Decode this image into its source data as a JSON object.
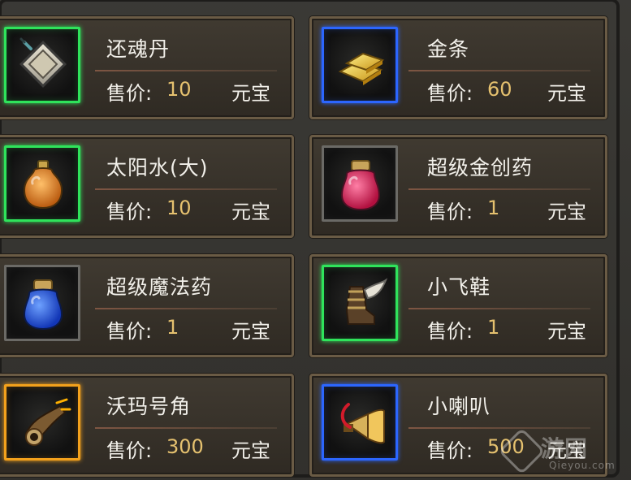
{
  "items": [
    {
      "name": "还魂丹",
      "price_label": "售价:",
      "price": "10",
      "currency": "元宝",
      "icon": "talisman-icon",
      "rarity": "green"
    },
    {
      "name": "金条",
      "price_label": "售价:",
      "price": "60",
      "currency": "元宝",
      "icon": "gold-bar-icon",
      "rarity": "blue"
    },
    {
      "name": "太阳水(大)",
      "price_label": "售价:",
      "price": "10",
      "currency": "元宝",
      "icon": "orange-potion-icon",
      "rarity": "green"
    },
    {
      "name": "超级金创药",
      "price_label": "售价:",
      "price": "1",
      "currency": "元宝",
      "icon": "red-potion-icon",
      "rarity": "gray"
    },
    {
      "name": "超级魔法药",
      "price_label": "售价:",
      "price": "1",
      "currency": "元宝",
      "icon": "blue-potion-icon",
      "rarity": "gray"
    },
    {
      "name": "小飞鞋",
      "price_label": "售价:",
      "price": "1",
      "currency": "元宝",
      "icon": "winged-boot-icon",
      "rarity": "green"
    },
    {
      "name": "沃玛号角",
      "price_label": "售价:",
      "price": "300",
      "currency": "元宝",
      "icon": "horn-icon",
      "rarity": "orange"
    },
    {
      "name": "小喇叭",
      "price_label": "售价:",
      "price": "500",
      "currency": "元宝",
      "icon": "megaphone-icon",
      "rarity": "blue"
    }
  ],
  "watermark": {
    "text": "游网",
    "sub": "Qieyou.com"
  }
}
